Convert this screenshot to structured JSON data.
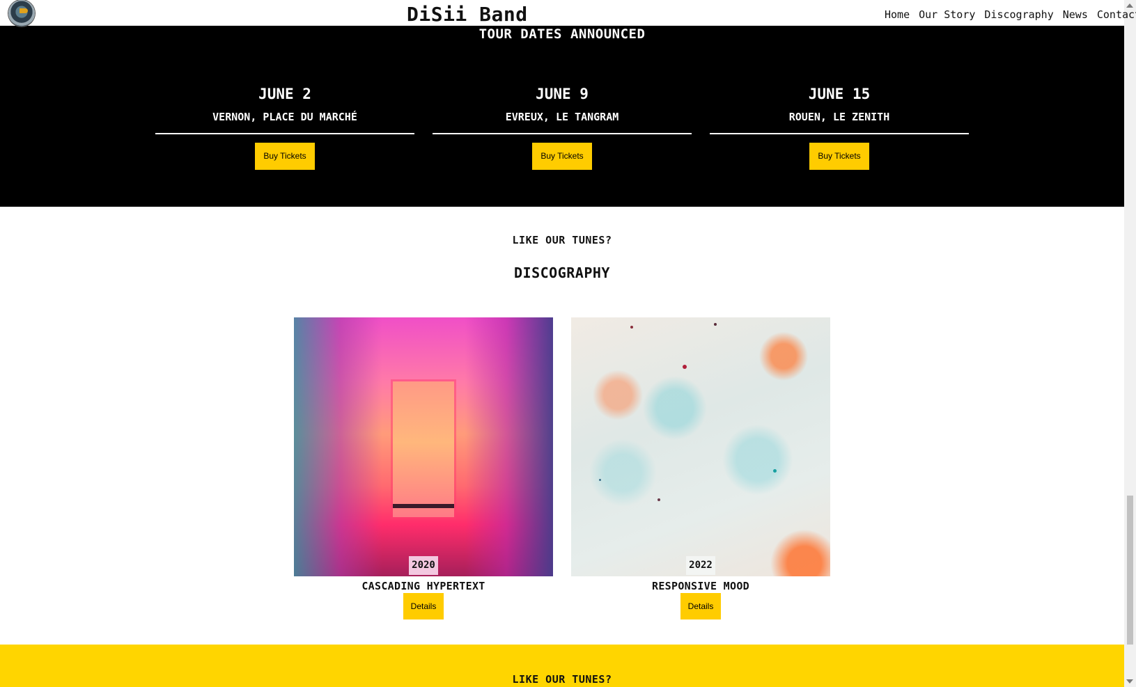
{
  "header": {
    "brand": "DiSii Band",
    "nav": [
      "Home",
      "Our Story",
      "Discography",
      "News",
      "Contact"
    ]
  },
  "tour": {
    "title": "TOUR DATES ANNOUNCED",
    "dates": [
      {
        "date": "JUNE 2",
        "venue": "VERNON, PLACE DU MARCHÉ",
        "button": "Buy Tickets"
      },
      {
        "date": "JUNE 9",
        "venue": "EVREUX, LE TANGRAM",
        "button": "Buy Tickets"
      },
      {
        "date": "JUNE 15",
        "venue": "ROUEN, LE ZENITH",
        "button": "Buy Tickets"
      }
    ]
  },
  "discography": {
    "subtitle": "LIKE OUR TUNES?",
    "title": "DISCOGRAPHY",
    "albums": [
      {
        "year": "2020",
        "name": "CASCADING HYPERTEXT",
        "button": "Details"
      },
      {
        "year": "2022",
        "name": "RESPONSIVE MOOD",
        "button": "Details"
      }
    ]
  },
  "footer_band": {
    "subtitle": "LIKE OUR TUNES?"
  },
  "colors": {
    "accent": "#ffcc00",
    "tour_bg": "#000000",
    "band_bg": "#ffd500"
  }
}
